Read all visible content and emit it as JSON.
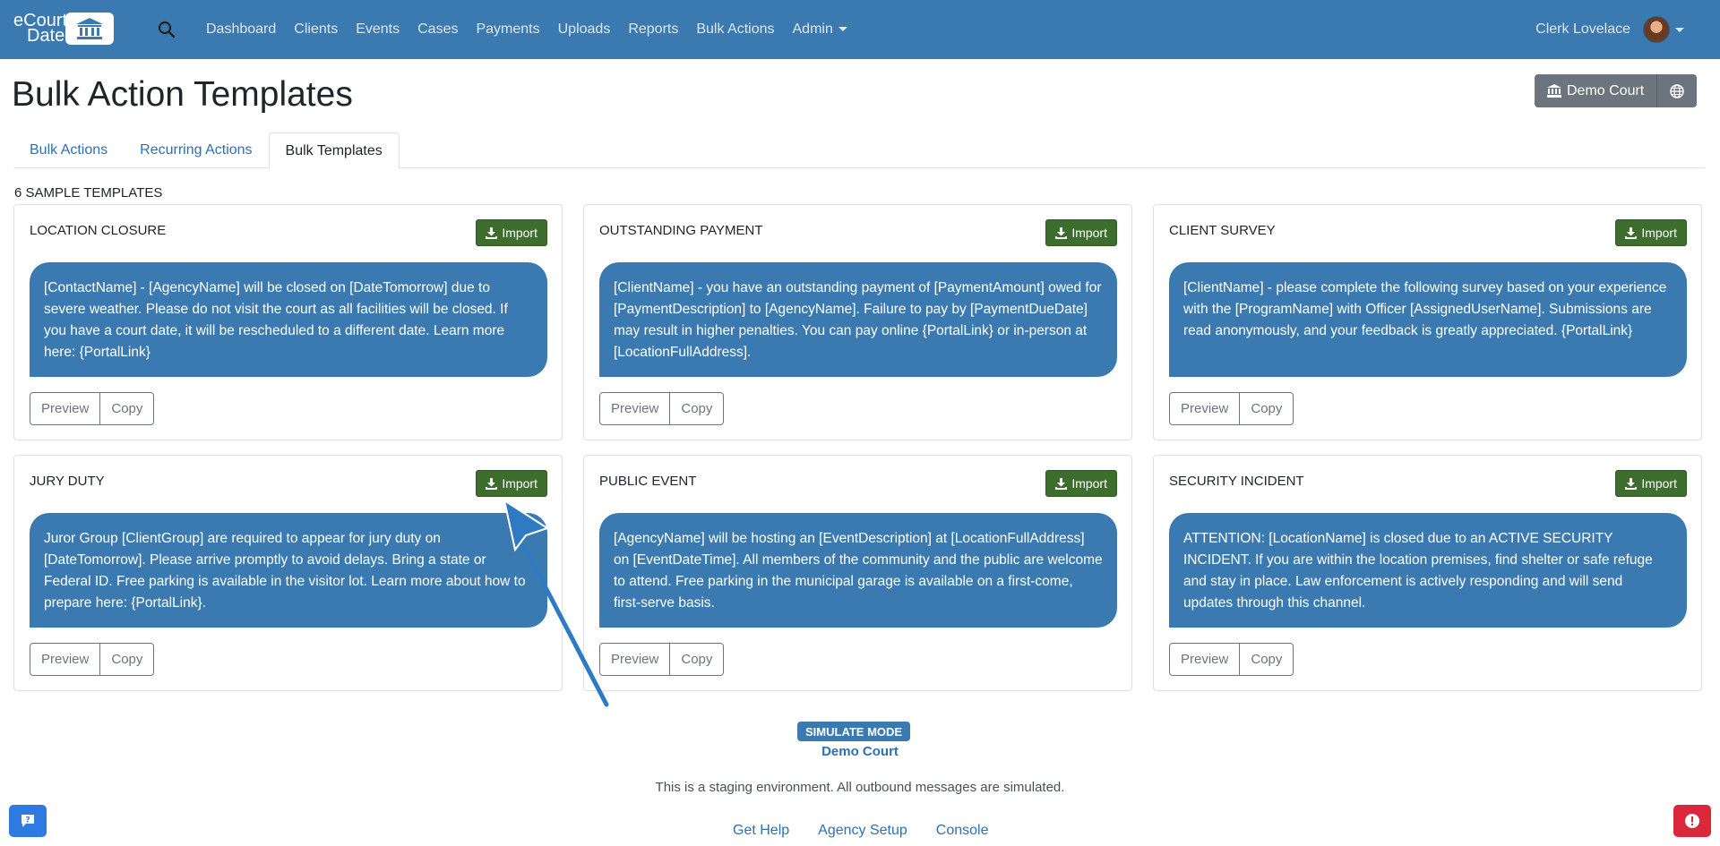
{
  "navbar": {
    "brand_line1": "eCourt",
    "brand_line2": "Date",
    "links": [
      "Dashboard",
      "Clients",
      "Events",
      "Cases",
      "Payments",
      "Uploads",
      "Reports",
      "Bulk Actions",
      "Admin"
    ],
    "user_name": "Clerk Lovelace"
  },
  "page": {
    "title": "Bulk Action Templates",
    "court_button": "Demo Court"
  },
  "tabs": [
    {
      "label": "Bulk Actions",
      "active": false
    },
    {
      "label": "Recurring Actions",
      "active": false
    },
    {
      "label": "Bulk Templates",
      "active": true
    }
  ],
  "templates_count_label": "6 SAMPLE TEMPLATES",
  "buttons": {
    "import": "Import",
    "preview": "Preview",
    "copy": "Copy"
  },
  "templates": [
    {
      "title": "LOCATION CLOSURE",
      "message": "[ContactName] - [AgencyName] will be closed on [DateTomorrow] due to severe weather. Please do not visit the court as all facilities will be closed. If you have a court date, it will be rescheduled to a different date. Learn more here: {PortalLink}"
    },
    {
      "title": "OUTSTANDING PAYMENT",
      "message": "[ClientName] - you have an outstanding payment of [PaymentAmount] owed for [PaymentDescription] to [AgencyName]. Failure to pay by [PaymentDueDate] may result in higher penalties. You can pay online {PortalLink} or in-person at [LocationFullAddress]."
    },
    {
      "title": "CLIENT SURVEY",
      "message": "[ClientName] - please complete the following survey based on your experience with the [ProgramName] with Officer [AssignedUserName]. Submissions are read anonymously, and your feedback is greatly appreciated. {PortalLink}"
    },
    {
      "title": "JURY DUTY",
      "message": "Juror Group [ClientGroup] are required to appear for jury duty on [DateTomorrow]. Please arrive promptly to avoid delays. Bring a state or Federal ID. Free parking is available in the visitor lot. Learn more about how to prepare here: {PortalLink}."
    },
    {
      "title": "PUBLIC EVENT",
      "message": "[AgencyName] will be hosting an [EventDescription] at [LocationFullAddress] on [EventDateTime]. All members of the community and the public are welcome to attend. Free parking in the municipal garage is available on a first-come, first-serve basis."
    },
    {
      "title": "SECURITY INCIDENT",
      "message": "ATTENTION: [LocationName] is closed due to an ACTIVE SECURITY INCIDENT. If you are within the location premises, find shelter or safe refuge and stay in place. Law enforcement is actively responding and will send updates through this channel."
    }
  ],
  "footer": {
    "simulate_badge": "SIMULATE MODE",
    "simulate_court": "Demo Court",
    "staging_notice": "This is a staging environment. All outbound messages are simulated.",
    "links": [
      "Get Help",
      "Agency Setup",
      "Console"
    ]
  },
  "icons": {
    "search": "search-icon",
    "court": "bank-icon",
    "globe": "globe-icon",
    "import": "download-icon",
    "chat": "chat-icon",
    "alert": "alert-icon",
    "annotation": "arrow-pointer"
  },
  "colors": {
    "navbar": "#3b7ab0",
    "bubble": "#3b7ab0",
    "import_button": "#3d6e2e",
    "link": "#2f6fb3",
    "alert": "#d9283c"
  }
}
